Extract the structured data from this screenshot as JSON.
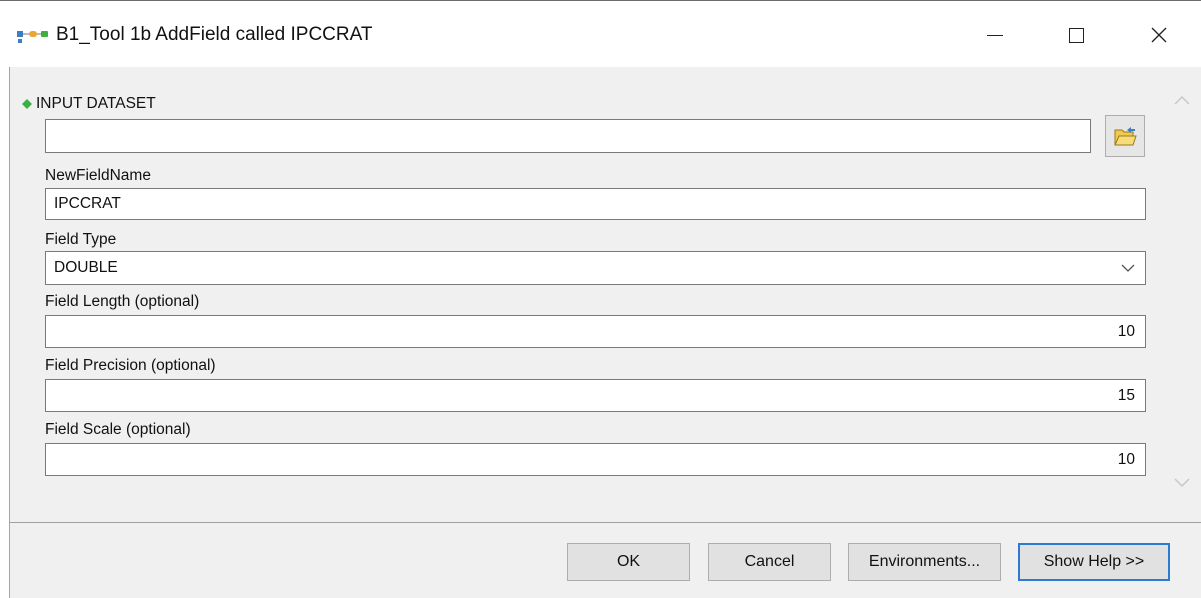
{
  "window": {
    "title": "B1_Tool 1b AddField called IPCCRAT",
    "icon": "model-tool-icon",
    "controls": [
      "minimize-icon",
      "maximize-icon",
      "close-icon"
    ]
  },
  "params": {
    "input_dataset": {
      "label": "INPUT DATASET",
      "value": "",
      "required_color": "#3cb043"
    },
    "new_field_name": {
      "label": "NewFieldName",
      "value": "IPCCRAT"
    },
    "field_type": {
      "label": "Field Type",
      "value": "DOUBLE"
    },
    "field_length": {
      "label": "Field Length (optional)",
      "value": "10"
    },
    "field_precision": {
      "label": "Field Precision (optional)",
      "value": "15"
    },
    "field_scale": {
      "label": "Field Scale (optional)",
      "value": "10"
    }
  },
  "buttons": {
    "ok": "OK",
    "cancel": "Cancel",
    "environments": "Environments...",
    "show_help": "Show Help >>"
  },
  "colors": {
    "focus_border": "#2b7bd3",
    "dialog_bg": "#f0f0f0"
  }
}
